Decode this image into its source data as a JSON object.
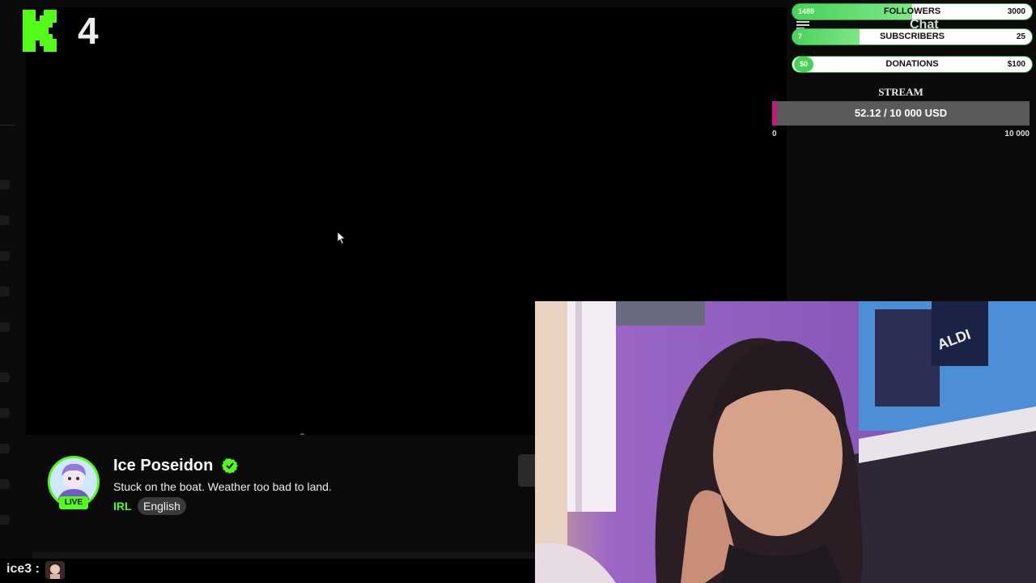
{
  "channel": {
    "number_badge": "4"
  },
  "goals": {
    "followers": {
      "current": "1489",
      "label": "FOLLOWERS",
      "max": "3000",
      "progress_fraction": 0.5
    },
    "subscribers": {
      "current": "7",
      "label": "SUBSCRIBERS",
      "max": "25",
      "progress_fraction": 0.28
    },
    "donations": {
      "current": "$0",
      "label": "DONATIONS",
      "max": "$100",
      "progress_fraction": 0.0
    }
  },
  "chat": {
    "header": "Chat"
  },
  "stream_goal": {
    "title": "STREAM",
    "progress_text": "52.12 / 10 000 USD",
    "progress_fraction": 0.0052,
    "min_label": "0",
    "max_label": "10 000"
  },
  "streamer": {
    "name": "Ice Poseidon",
    "live_label": "LIVE",
    "title": "Stuck on the boat. Weather too bad to land.",
    "category": "IRL",
    "language": "English"
  },
  "chat_message": {
    "username": "ice3 :"
  },
  "colors": {
    "accent": "#53fc18",
    "goal_green": "#4ad15a",
    "stream_fill": "#c21a7c"
  }
}
